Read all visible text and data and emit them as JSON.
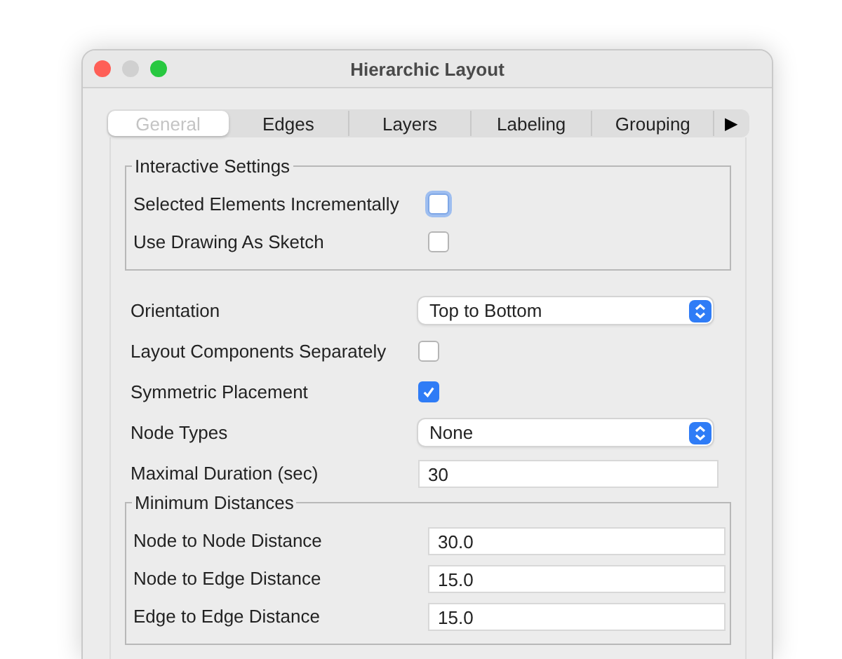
{
  "window": {
    "title": "Hierarchic Layout"
  },
  "tabs": [
    {
      "label": "General",
      "selected": true
    },
    {
      "label": "Edges",
      "selected": false
    },
    {
      "label": "Layers",
      "selected": false
    },
    {
      "label": "Labeling",
      "selected": false
    },
    {
      "label": "Grouping",
      "selected": false
    }
  ],
  "tab_overflow": "▶",
  "sections": [
    {
      "kind": "group",
      "title": "Interactive Settings",
      "rows": [
        {
          "kind": "checkbox",
          "label": "Selected Elements Incrementally",
          "checked": false,
          "focused": true
        },
        {
          "kind": "checkbox",
          "label": "Use Drawing As Sketch",
          "checked": false,
          "focused": false
        }
      ]
    },
    {
      "kind": "plain",
      "rows": [
        {
          "kind": "dropdown",
          "label": "Orientation",
          "value": "Top to Bottom"
        },
        {
          "kind": "checkbox",
          "label": "Layout Components Separately",
          "checked": false,
          "focused": false
        },
        {
          "kind": "checkbox",
          "label": "Symmetric Placement",
          "checked": true,
          "focused": false
        },
        {
          "kind": "dropdown",
          "label": "Node Types",
          "value": "None"
        },
        {
          "kind": "text",
          "label": "Maximal Duration (sec)",
          "value": "30"
        }
      ]
    },
    {
      "kind": "group",
      "title": "Minimum Distances",
      "rows": [
        {
          "kind": "text",
          "label": "Node to Node Distance",
          "value": "30.0"
        },
        {
          "kind": "text",
          "label": "Node to Edge Distance",
          "value": "15.0"
        },
        {
          "kind": "text",
          "label": "Edge to Edge Distance",
          "value": "15.0"
        }
      ]
    }
  ]
}
